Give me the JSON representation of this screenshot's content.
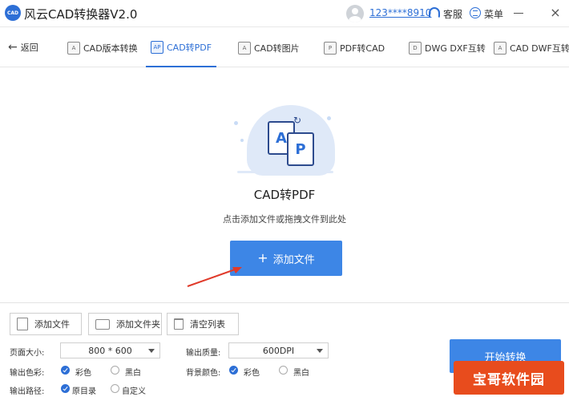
{
  "titlebar": {
    "logo_text": "CAD",
    "app_title": "风云CAD转换器V2.0",
    "user": "123****8910",
    "service_label": "客服",
    "menu_label": "菜单",
    "minimize_icon": "minimize-icon",
    "close_glyph": "×"
  },
  "tabs": {
    "back_label": "返回",
    "items": [
      {
        "label": "CAD版本转换",
        "icon": "cad-version-icon",
        "active": false
      },
      {
        "label": "CAD转PDF",
        "icon": "cad-to-pdf-icon",
        "active": true
      },
      {
        "label": "CAD转图片",
        "icon": "cad-to-image-icon",
        "active": false
      },
      {
        "label": "PDF转CAD",
        "icon": "pdf-to-cad-icon",
        "active": false
      },
      {
        "label": "DWG DXF互转",
        "icon": "dwg-dxf-icon",
        "active": false
      },
      {
        "label": "CAD DWF互转",
        "icon": "cad-dwf-icon",
        "active": false
      }
    ]
  },
  "main": {
    "title": "CAD转PDF",
    "subtitle": "点击添加文件或拖拽文件到此处",
    "add_button": "添加文件"
  },
  "toolbar": {
    "add_file": "添加文件",
    "add_folder": "添加文件夹",
    "clear_list": "清空列表"
  },
  "settings": {
    "page_size_label": "页面大小:",
    "page_size_value": "800 * 600",
    "output_quality_label": "输出质量:",
    "output_quality_value": "600DPI",
    "output_color_label": "输出色彩:",
    "output_color_options": [
      "彩色",
      "黑白"
    ],
    "output_color_selected": "彩色",
    "bg_color_label": "背景颜色:",
    "bg_color_options": [
      "彩色",
      "黑白"
    ],
    "bg_color_selected": "彩色",
    "output_path_label": "输出路径:",
    "output_path_options": [
      "原目录",
      "自定义"
    ],
    "output_path_selected": "原目录"
  },
  "start_button": "开始转换",
  "watermark": "宝哥软件园",
  "colors": {
    "accent": "#2d6fd6",
    "button": "#3d86e6",
    "watermark": "#e84c1d"
  }
}
